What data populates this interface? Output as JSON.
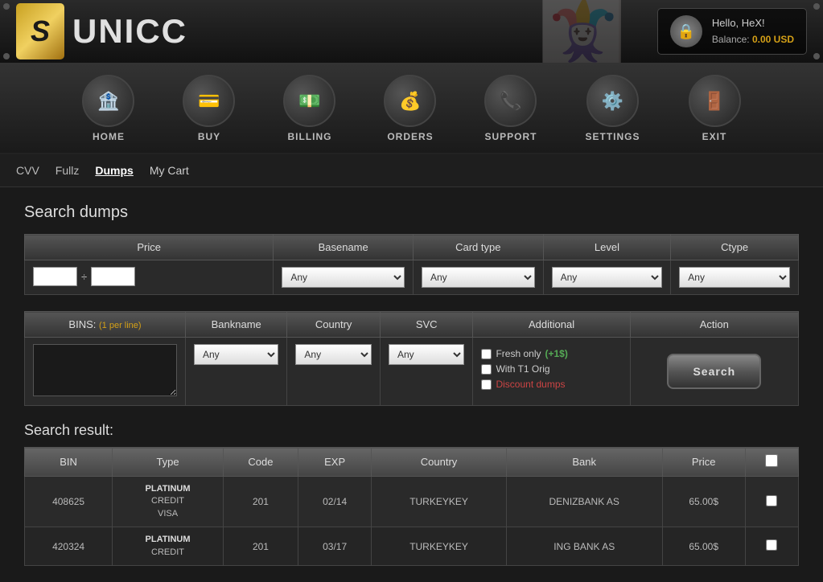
{
  "header": {
    "logo_letter": "S",
    "logo_name": "UNICC",
    "user_greeting": "Hello, HeX!",
    "balance_label": "Balance:",
    "balance_amount": "0.00 USD",
    "corner_dots": [
      "top-left",
      "top-right",
      "bottom-left",
      "bottom-right"
    ]
  },
  "nav": {
    "items": [
      {
        "id": "home",
        "label": "HOME",
        "icon": "🏦"
      },
      {
        "id": "buy",
        "label": "BUY",
        "icon": "💳"
      },
      {
        "id": "billing",
        "label": "BILLING",
        "icon": "💵"
      },
      {
        "id": "orders",
        "label": "ORDERS",
        "icon": "💰"
      },
      {
        "id": "support",
        "label": "SUPPORT",
        "icon": "📞"
      },
      {
        "id": "settings",
        "label": "SETTINGS",
        "icon": "⚙️"
      },
      {
        "id": "exit",
        "label": "EXIT",
        "icon": "🔫"
      }
    ]
  },
  "sub_nav": {
    "items": [
      {
        "label": "CVV",
        "active": false
      },
      {
        "label": "Fullz",
        "active": false
      },
      {
        "label": "Dumps",
        "active": true
      },
      {
        "label": "My Cart",
        "active": false
      }
    ]
  },
  "search": {
    "title": "Search dumps",
    "price_label": "Price",
    "basename_label": "Basename",
    "card_type_label": "Card type",
    "level_label": "Level",
    "ctype_label": "Ctype",
    "bins_label": "BINS:",
    "bins_hint": "(1 per line)",
    "bankname_label": "Bankname",
    "country_label": "Country",
    "svc_label": "SVC",
    "additional_label": "Additional",
    "action_label": "Action",
    "price_min": "",
    "price_max": "",
    "basename_options": [
      "Any"
    ],
    "card_type_options": [
      "Any"
    ],
    "level_options": [
      "Any"
    ],
    "ctype_options": [
      "Any"
    ],
    "bankname_options": [
      "Any"
    ],
    "country_options": [
      "Any"
    ],
    "svc_options": [
      "Any"
    ],
    "fresh_only_label": "Fresh only",
    "fresh_price": "(+1$)",
    "with_t1_label": "With T1 Orig",
    "discount_label": "Discount dumps",
    "search_button": "Search"
  },
  "results": {
    "title": "Search result:",
    "columns": [
      "BIN",
      "Type",
      "Code",
      "EXP",
      "Country",
      "Bank",
      "Price",
      ""
    ],
    "rows": [
      {
        "bin": "408625",
        "type_line1": "PLATINUM",
        "type_line2": "CREDIT",
        "type_line3": "VISA",
        "code": "201",
        "exp": "02/14",
        "country": "TURKEYKEY",
        "bank": "DENIZBANK AS",
        "price": "65.00$",
        "checked": false
      },
      {
        "bin": "420324",
        "type_line1": "PLATINUM",
        "type_line2": "CREDIT",
        "type_line3": "",
        "code": "201",
        "exp": "03/17",
        "country": "TURKEYKEY",
        "bank": "ING BANK AS",
        "price": "65.00$",
        "checked": false
      }
    ]
  }
}
